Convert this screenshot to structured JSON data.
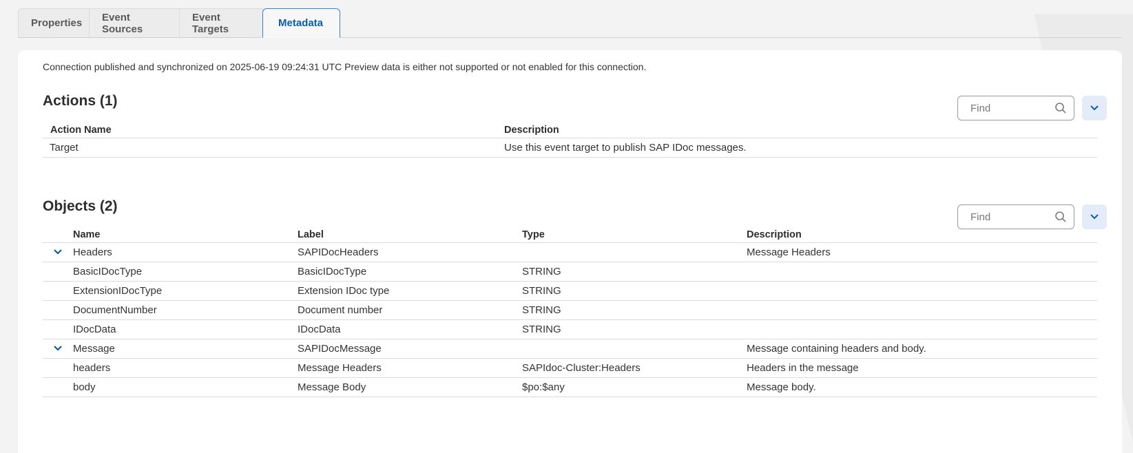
{
  "tabs": [
    {
      "label": "Properties"
    },
    {
      "label": "Event Sources"
    },
    {
      "label": "Event Targets"
    },
    {
      "label": "Metadata"
    }
  ],
  "status_text": "Connection published and synchronized on 2025-06-19 09:24:31 UTC Preview data is either not supported or not enabled for this connection.",
  "actions": {
    "title": "Actions (1)",
    "find_placeholder": "Find",
    "columns": {
      "name": "Action Name",
      "description": "Description"
    },
    "rows": [
      {
        "name": "Target",
        "description": "Use this event target to publish SAP IDoc messages."
      }
    ]
  },
  "objects": {
    "title": "Objects (2)",
    "find_placeholder": "Find",
    "columns": {
      "name": "Name",
      "label": "Label",
      "type": "Type",
      "description": "Description"
    },
    "rows": [
      {
        "name": "Headers",
        "label": "SAPIDocHeaders",
        "type": "",
        "description": "Message Headers",
        "expandable": true
      },
      {
        "name": "BasicIDocType",
        "label": "BasicIDocType",
        "type": "STRING",
        "description": ""
      },
      {
        "name": "ExtensionIDocType",
        "label": "Extension IDoc type",
        "type": "STRING",
        "description": ""
      },
      {
        "name": "DocumentNumber",
        "label": "Document number",
        "type": "STRING",
        "description": ""
      },
      {
        "name": "IDocData",
        "label": "IDocData",
        "type": "STRING",
        "description": ""
      },
      {
        "name": "Message",
        "label": "SAPIDocMessage",
        "type": "",
        "description": "Message containing headers and body.",
        "expandable": true
      },
      {
        "name": "headers",
        "label": "Message Headers",
        "type": "SAPIdoc-Cluster:Headers",
        "description": "Headers in the message"
      },
      {
        "name": "body",
        "label": "Message Body",
        "type": "$po:$any",
        "description": "Message body."
      }
    ]
  },
  "icons": {
    "find": "search-icon",
    "collapse": "chevron-down-icon"
  },
  "colors": {
    "accent": "#0b5cad",
    "chevron_button_bg": "#e3ecf8"
  }
}
